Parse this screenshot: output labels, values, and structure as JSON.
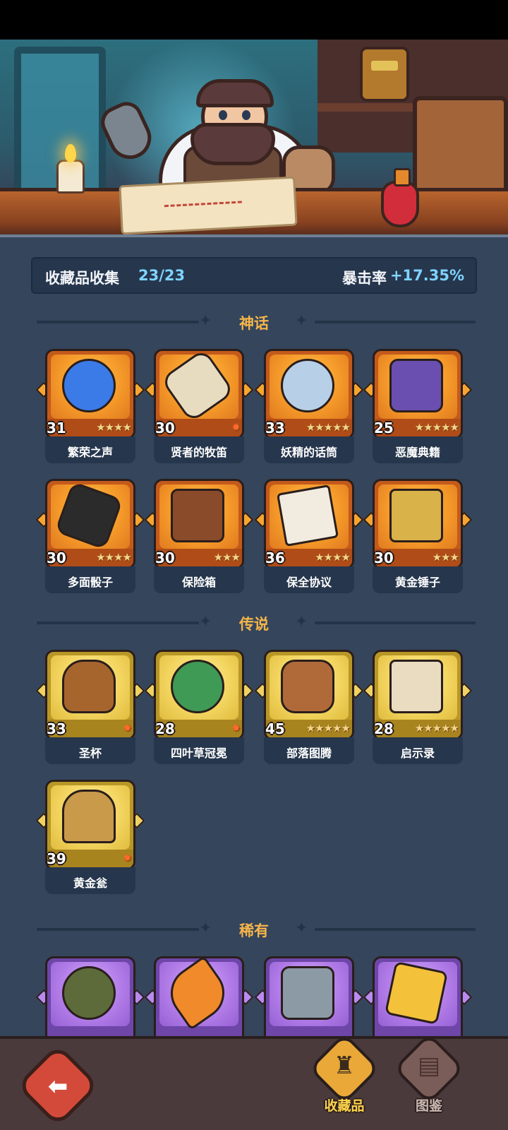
{
  "summary": {
    "collection_label": "收藏品收集",
    "collection_count": "23/23",
    "crit_label": "暴击率",
    "crit_value": "+17.35%"
  },
  "sections": {
    "mythic": "神话",
    "legend": "传说",
    "rare": "稀有"
  },
  "mythic_items": [
    {
      "name": "繁荣之声",
      "level": "31",
      "stars": "★★★★",
      "icon": "blue-spirit-icon"
    },
    {
      "name": "贤者的牧笛",
      "level": "30",
      "stars": "✹",
      "icon": "flute-icon"
    },
    {
      "name": "妖精的话筒",
      "level": "33",
      "stars": "★★★★★",
      "icon": "fairy-microphone-icon"
    },
    {
      "name": "恶魔典籍",
      "level": "25",
      "stars": "★★★★★",
      "icon": "demon-book-icon"
    },
    {
      "name": "多面骰子",
      "level": "30",
      "stars": "★★★★",
      "icon": "dice-icon"
    },
    {
      "name": "保险箱",
      "level": "30",
      "stars": "★★★",
      "icon": "treasure-chest-icon"
    },
    {
      "name": "保全协议",
      "level": "36",
      "stars": "★★★★",
      "icon": "contract-scroll-icon"
    },
    {
      "name": "黄金锤子",
      "level": "30",
      "stars": "★★★",
      "icon": "golden-hammer-icon"
    }
  ],
  "legend_items": [
    {
      "name": "圣杯",
      "level": "33",
      "stars": "✹",
      "icon": "grail-icon"
    },
    {
      "name": "四叶草冠冕",
      "level": "28",
      "stars": "✹",
      "icon": "clover-crown-icon"
    },
    {
      "name": "部落图腾",
      "level": "45",
      "stars": "★★★★★",
      "icon": "tribal-totem-icon"
    },
    {
      "name": "启示录",
      "level": "28",
      "stars": "★★★★★",
      "icon": "open-book-icon"
    },
    {
      "name": "黄金瓮",
      "level": "39",
      "stars": "✹",
      "icon": "golden-urn-icon"
    }
  ],
  "rare_items": [
    {
      "icon": "thorn-vine-icon"
    },
    {
      "icon": "phoenix-feather-icon"
    },
    {
      "icon": "axe-icon"
    },
    {
      "icon": "lightning-card-icon"
    }
  ],
  "nav": {
    "collect_label": "收藏品",
    "codex_label": "图鉴",
    "back_icon": "back-arrow-icon"
  },
  "colors": {
    "panel": "#34455c",
    "accent_title": "#f5b54a",
    "accent_value": "#7fd3ff",
    "mythic": "#f59a2a",
    "legend": "#f3d560",
    "rare": "#b27de8"
  }
}
